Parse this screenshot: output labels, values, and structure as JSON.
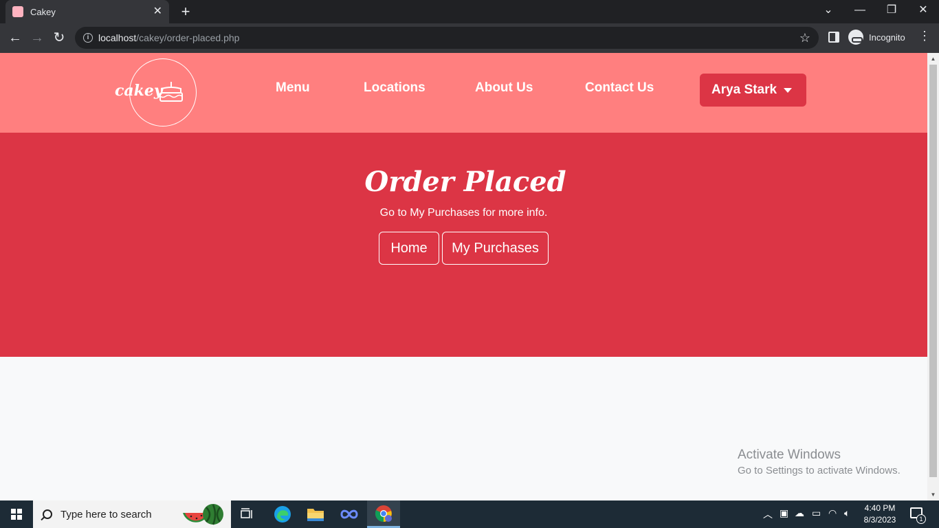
{
  "browser": {
    "tab_title": "Cakey",
    "new_tab_symbol": "+",
    "url_host": "localhost",
    "url_path": "/cakey/order-placed.php",
    "incognito_label": "Incognito"
  },
  "site": {
    "logo_text": "cakey",
    "nav_links": [
      "Menu",
      "Locations",
      "About Us",
      "Contact Us"
    ],
    "user_name": "Arya Stark"
  },
  "hero": {
    "title": "Order Placed",
    "subtitle": "Go to My Purchases for more info.",
    "buttons": [
      "Home",
      "My Purchases"
    ]
  },
  "colors": {
    "nav_bg": "#ff7f7f",
    "hero_bg": "#dc3545",
    "user_button_bg": "#dc3545",
    "page_bg": "#f8f9fa"
  },
  "watermark": {
    "line1": "Activate Windows",
    "line2": "Go to Settings to activate Windows."
  },
  "taskbar": {
    "search_placeholder": "Type here to search",
    "time": "4:40 PM",
    "date": "8/3/2023",
    "notification_count": "1"
  }
}
